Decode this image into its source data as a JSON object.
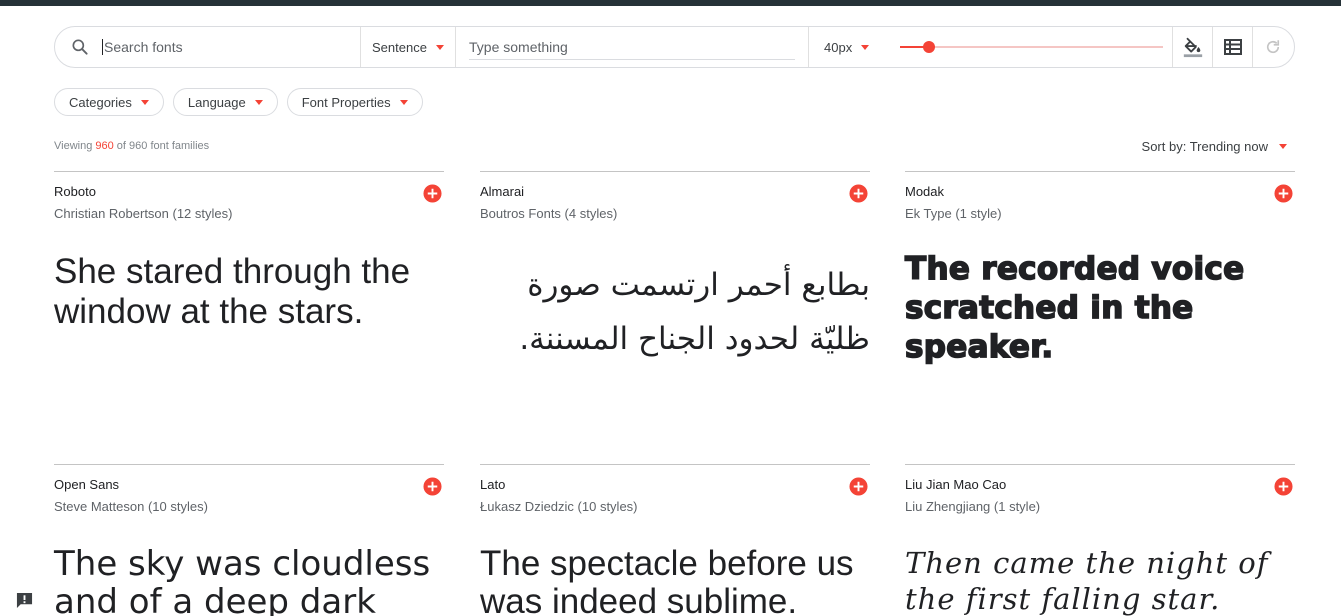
{
  "colors": {
    "accent": "#f44336",
    "topbar": "#263238",
    "text": "#202124",
    "muted": "#5f6368"
  },
  "toolbar": {
    "search_placeholder": "Search fonts",
    "sentence_label": "Sentence",
    "type_placeholder": "Type something",
    "size_label": "40px",
    "size_slider_fraction": 0.11,
    "icons": [
      "search-icon",
      "paint-bucket-icon",
      "grid-view-icon",
      "refresh-icon"
    ]
  },
  "filters": [
    "Categories",
    "Language",
    "Font Properties"
  ],
  "listing": {
    "viewing_prefix": "Viewing ",
    "viewing_count": "960",
    "viewing_suffix": " of 960 font families",
    "sort_label": "Sort by: Trending now"
  },
  "fonts": [
    {
      "name": "Roboto",
      "designer": "Christian Robertson (12 styles)",
      "sample": "She stared through the window at the stars."
    },
    {
      "name": "Almarai",
      "designer": "Boutros Fonts (4 styles)",
      "sample": "بطابع أحمر ارتسمت صورة ظليّة لحدود الجناح المسننة."
    },
    {
      "name": "Modak",
      "designer": "Ek Type (1 style)",
      "sample": "The recorded voice scratched in the speaker."
    },
    {
      "name": "Open Sans",
      "designer": "Steve Matteson (10 styles)",
      "sample": "The sky was cloudless and of a deep dark"
    },
    {
      "name": "Lato",
      "designer": "Łukasz Dziedzic (10 styles)",
      "sample": "The spectacle before us was indeed sublime."
    },
    {
      "name": "Liu Jian Mao Cao",
      "designer": "Liu Zhengjiang (1 style)",
      "sample": "Then came the night of the first falling star."
    }
  ]
}
